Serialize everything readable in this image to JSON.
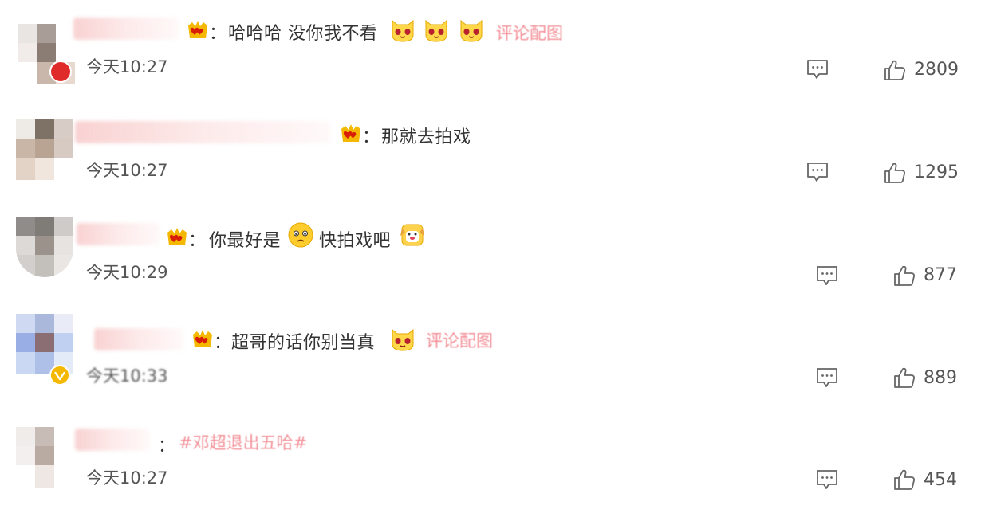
{
  "comments": [
    {
      "text": "哈哈哈 没你我不看",
      "link": "评论配图",
      "time": "今天10:27",
      "likes": "2809"
    },
    {
      "text": "那就去拍戏",
      "time": "今天10:27",
      "likes": "1295"
    },
    {
      "text_a": "你最好是",
      "text_b": "快拍戏吧",
      "time": "今天10:29",
      "likes": "877"
    },
    {
      "text": "超哥的话你别当真",
      "link": "评论配图",
      "time": "今天10:33",
      "likes": "889"
    },
    {
      "hashtag": "#邓超退出五哈#",
      "time": "今天10:27",
      "likes": "454"
    }
  ],
  "colon": "：",
  "icons": {
    "badge": "crown-heart-icon",
    "reply": "comment-icon",
    "like": "thumbs-up-icon",
    "verified": "verified-v-icon"
  },
  "colors": {
    "link": "#f07b84",
    "muted": "#555555",
    "badge": "#f5b800"
  }
}
